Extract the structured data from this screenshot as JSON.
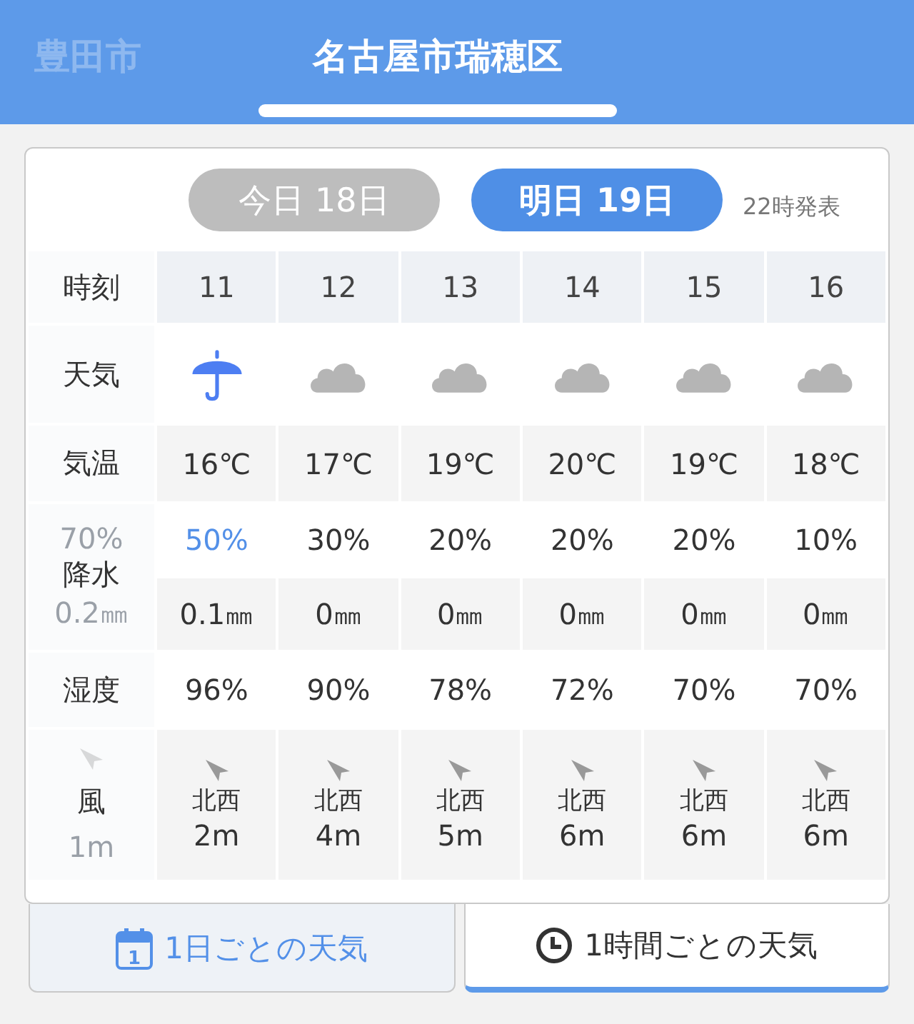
{
  "location_tabs": [
    {
      "label": "豊田市",
      "selected": false
    },
    {
      "label": "名古屋市瑞穂区",
      "selected": true
    }
  ],
  "day_tabs": [
    {
      "label": "今日 18日",
      "selected": false
    },
    {
      "label": "明日 19日",
      "selected": true
    }
  ],
  "issued": "22時発表",
  "row_labels": {
    "time": "時刻",
    "weather": "天気",
    "temp": "気温",
    "precip": "降水",
    "humidity": "湿度",
    "wind": "風"
  },
  "scrolled_under": {
    "precip": "70%",
    "amount": "0.2㎜",
    "wind_speed": "1m"
  },
  "hours": [
    {
      "time": "11",
      "kind": "rain",
      "temp": "16℃",
      "precip": "50%",
      "emphasized": true,
      "amount": "0.1㎜",
      "humidity": "96%",
      "wind_dir": "北西",
      "wind_speed": "2m"
    },
    {
      "time": "12",
      "kind": "cloud",
      "temp": "17℃",
      "precip": "30%",
      "emphasized": false,
      "amount": "0㎜",
      "humidity": "90%",
      "wind_dir": "北西",
      "wind_speed": "4m"
    },
    {
      "time": "13",
      "kind": "cloud",
      "temp": "19℃",
      "precip": "20%",
      "emphasized": false,
      "amount": "0㎜",
      "humidity": "78%",
      "wind_dir": "北西",
      "wind_speed": "5m"
    },
    {
      "time": "14",
      "kind": "cloud",
      "temp": "20℃",
      "precip": "20%",
      "emphasized": false,
      "amount": "0㎜",
      "humidity": "72%",
      "wind_dir": "北西",
      "wind_speed": "6m"
    },
    {
      "time": "15",
      "kind": "cloud",
      "temp": "19℃",
      "precip": "20%",
      "emphasized": false,
      "amount": "0㎜",
      "humidity": "70%",
      "wind_dir": "北西",
      "wind_speed": "6m"
    },
    {
      "time": "16",
      "kind": "cloud",
      "temp": "18℃",
      "precip": "10%",
      "emphasized": false,
      "amount": "0㎜",
      "humidity": "70%",
      "wind_dir": "北西",
      "wind_speed": "6m"
    }
  ],
  "view_tabs": [
    {
      "kind": "daily",
      "label": "1日ごとの天気",
      "icon_text": "1",
      "selected": false
    },
    {
      "kind": "hourly",
      "label": "1時間ごとの天気",
      "selected": true
    }
  ]
}
